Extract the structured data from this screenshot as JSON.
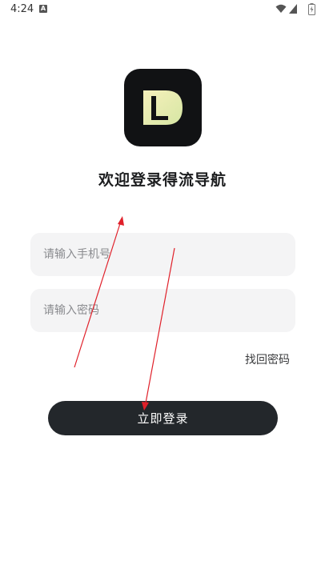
{
  "status_bar": {
    "time": "4:24",
    "notification_icon": "a-icon",
    "wifi_icon": "wifi-icon",
    "signal_icon": "signal-icon",
    "battery_icon": "battery-icon"
  },
  "logo": {
    "letter": "L",
    "icon": "app-logo-icon"
  },
  "welcome_title": "欢迎登录得流导航",
  "form": {
    "phone_placeholder": "请输入手机号",
    "password_placeholder": "请输入密码",
    "forgot_password": "找回密码",
    "login_button": "立即登录"
  },
  "colors": {
    "logo_background": "#111214",
    "logo_gradient_start": "#f4efb8",
    "logo_gradient_end": "#d8e7a8",
    "button_background": "#23272b",
    "field_background": "#f4f4f5",
    "annotation_arrow": "#e0202a"
  }
}
